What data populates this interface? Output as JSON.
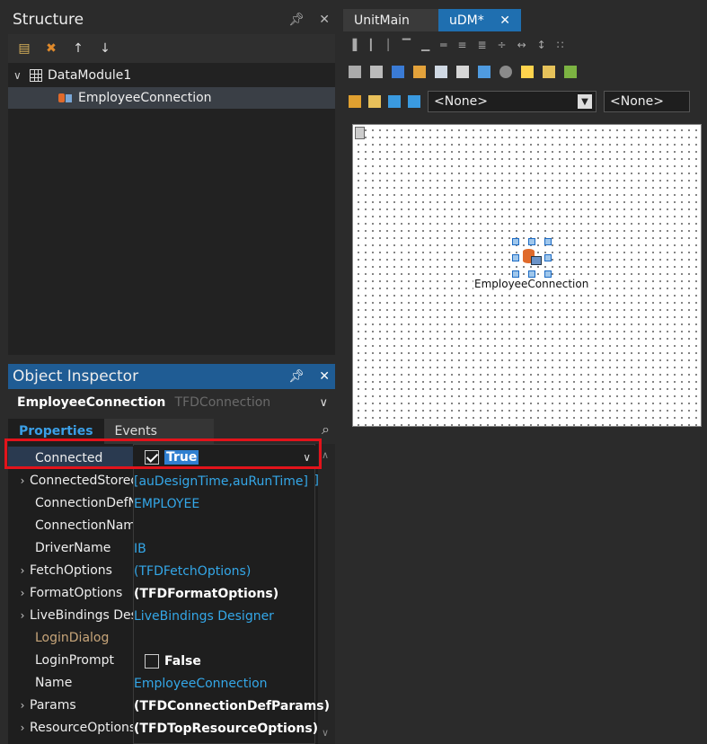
{
  "structure": {
    "title": "Structure",
    "pin": "↔",
    "close": "✕",
    "tree": {
      "root": "DataModule1",
      "child": "EmployeeConnection"
    }
  },
  "object_inspector": {
    "title": "Object Inspector",
    "component_name": "EmployeeConnection",
    "component_type": "TFDConnection",
    "tabs": [
      "Properties",
      "Events"
    ],
    "properties": [
      {
        "name": "Connected",
        "value": "",
        "expandable": false
      },
      {
        "name": "ConnectedStoredUsage",
        "value": "[auDesignTime,auRunTime]",
        "expandable": true
      },
      {
        "name": "ConnectionDefName",
        "value": "EMPLOYEE",
        "expandable": false
      },
      {
        "name": "ConnectionName",
        "value": "",
        "expandable": false
      },
      {
        "name": "DriverName",
        "value": "IB",
        "expandable": false
      },
      {
        "name": "FetchOptions",
        "value": "(TFDFetchOptions)",
        "expandable": true
      },
      {
        "name": "FormatOptions",
        "value": "(TFDFormatOptions)",
        "expandable": true
      },
      {
        "name": "LiveBindings Designer",
        "value": "LiveBindings Designer",
        "expandable": true
      },
      {
        "name": "LoginDialog",
        "value": "",
        "expandable": false
      },
      {
        "name": "LoginPrompt",
        "value": "False",
        "expandable": false
      },
      {
        "name": "Name",
        "value": "EmployeeConnection",
        "expandable": false
      },
      {
        "name": "Params",
        "value": "(TFDConnectionDefParams)",
        "expandable": true
      },
      {
        "name": "ResourceOptions",
        "value": "(TFDTopResourceOptions)",
        "expandable": true
      }
    ],
    "editor": {
      "current_value": "True",
      "checked": true
    }
  },
  "editor_tabs": [
    "UnitMain",
    "uDM*"
  ],
  "combos": [
    "<None>",
    "<None>"
  ],
  "designer": {
    "component_label": "EmployeeConnection"
  },
  "colors": {
    "accent": "#1f6fb0",
    "value_blue": "#34a7e8",
    "highlight": "#e3131b"
  }
}
